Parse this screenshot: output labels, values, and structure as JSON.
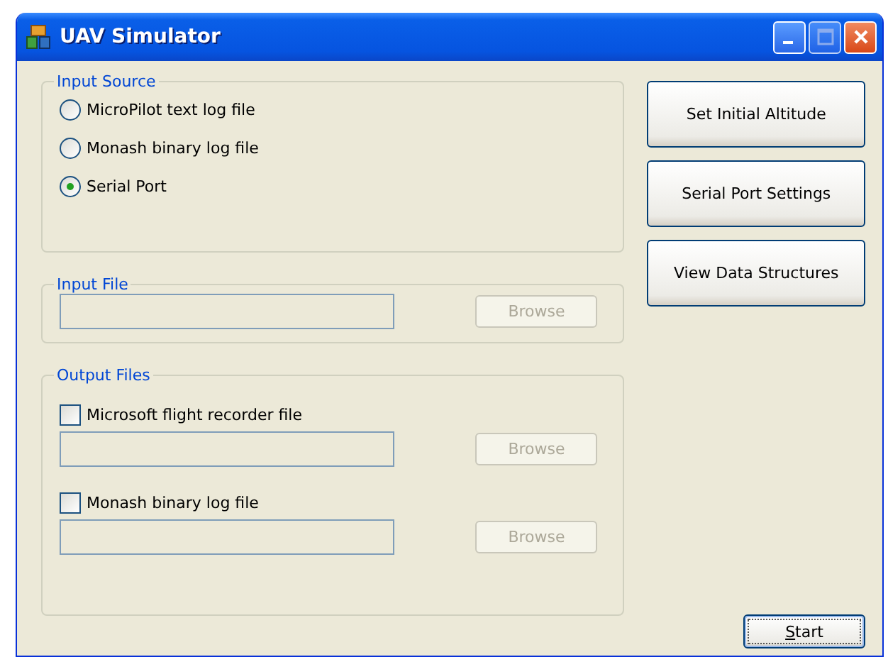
{
  "window": {
    "title": "UAV Simulator"
  },
  "input_source": {
    "label": "Input Source",
    "options": [
      {
        "label": "MicroPilot text log file",
        "selected": false
      },
      {
        "label": "Monash binary log file",
        "selected": false
      },
      {
        "label": "Serial Port",
        "selected": true
      }
    ]
  },
  "input_file": {
    "label": "Input File",
    "browse": {
      "label": "Browse",
      "disabled": true
    }
  },
  "output_files": {
    "label": "Output Files",
    "items": [
      {
        "label": "Microsoft flight recorder file",
        "checked": false,
        "browse": {
          "label": "Browse",
          "disabled": true
        }
      },
      {
        "label": "Monash binary log file",
        "checked": false,
        "browse": {
          "label": "Browse",
          "disabled": true
        }
      }
    ]
  },
  "side_buttons": [
    "Set Initial Altitude",
    "Serial Port Settings",
    "View Data Structures"
  ],
  "start_button": "Start"
}
